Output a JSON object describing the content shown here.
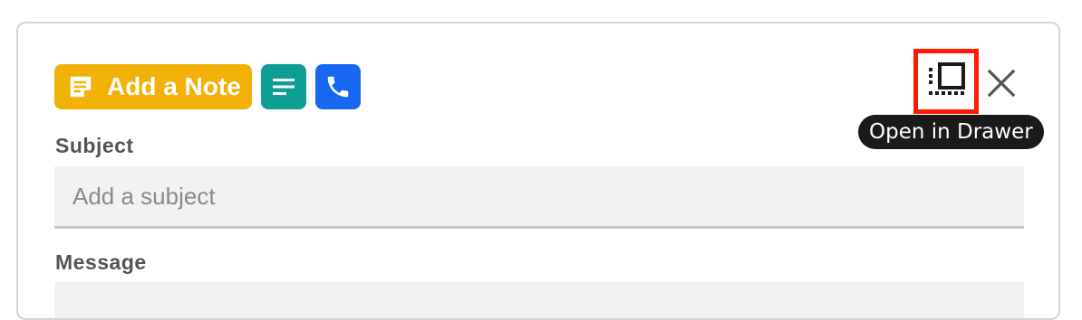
{
  "toolbar": {
    "add_note_label": "Add a Note",
    "note_icon": "note-icon",
    "text_icon": "text-lines-icon",
    "phone_icon": "phone-icon",
    "colors": {
      "note": "#f2b106",
      "text": "#0e9e94",
      "phone": "#1767f1"
    }
  },
  "header_actions": {
    "open_drawer_icon": "open-in-drawer-icon",
    "close_icon": "close-icon",
    "tooltip": "Open in Drawer",
    "highlight_color": "#ff1a00"
  },
  "form": {
    "subject_label": "Subject",
    "subject_placeholder": "Add a subject",
    "subject_value": "",
    "message_label": "Message"
  }
}
